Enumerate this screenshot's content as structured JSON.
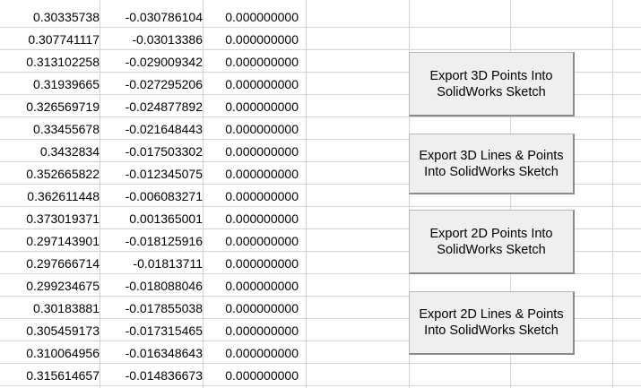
{
  "sheet": {
    "rows": [
      [
        "0.30335738",
        "-0.030786104",
        "0.000000000"
      ],
      [
        "0.307741117",
        "-0.03013386",
        "0.000000000"
      ],
      [
        "0.313102258",
        "-0.029009342",
        "0.000000000"
      ],
      [
        "0.31939665",
        "-0.027295206",
        "0.000000000"
      ],
      [
        "0.326569719",
        "-0.024877892",
        "0.000000000"
      ],
      [
        "0.33455678",
        "-0.021648443",
        "0.000000000"
      ],
      [
        "0.3432834",
        "-0.017503302",
        "0.000000000"
      ],
      [
        "0.352665822",
        "-0.012345075",
        "0.000000000"
      ],
      [
        "0.362611448",
        "-0.006083271",
        "0.000000000"
      ],
      [
        "0.373019371",
        "0.001365001",
        "0.000000000"
      ],
      [
        "0.297143901",
        "-0.018125916",
        "0.000000000"
      ],
      [
        "0.297666714",
        "-0.01813711",
        "0.000000000"
      ],
      [
        "0.299234675",
        "-0.018088046",
        "0.000000000"
      ],
      [
        "0.30183881",
        "-0.017855038",
        "0.000000000"
      ],
      [
        "0.305459173",
        "-0.017315465",
        "0.000000000"
      ],
      [
        "0.310064956",
        "-0.016348643",
        "0.000000000"
      ],
      [
        "0.315614657",
        "-0.014836673",
        "0.000000000"
      ]
    ]
  },
  "buttons": {
    "export_3d_points": "Export 3D Points Into SolidWorks Sketch",
    "export_3d_lines_points": "Export 3D Lines & Points Into SolidWorks Sketch",
    "export_2d_points": "Export 2D Points Into SolidWorks Sketch",
    "export_2d_lines_points": "Export 2D Lines & Points Into SolidWorks Sketch"
  }
}
